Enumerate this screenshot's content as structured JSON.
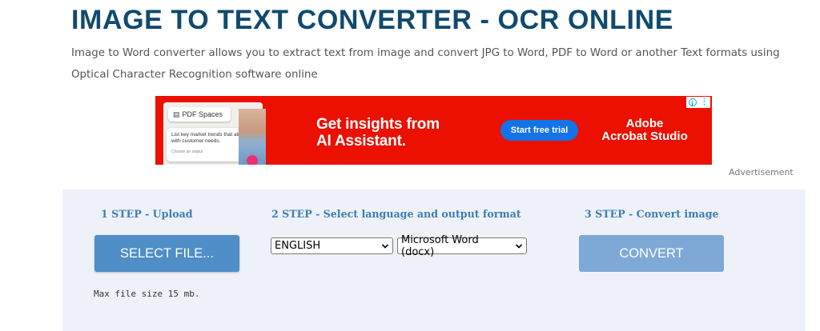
{
  "header": {
    "title": "IMAGE TO TEXT CONVERTER - OCR ONLINE",
    "description": "Image to Word converter allows you to extract text from image and convert JPG to Word, PDF to Word or another Text formats using Optical Character Recognition software online"
  },
  "ad": {
    "mock_chip": "PDF Spaces",
    "mock_prompt": "List key market trends that align with customer needs.",
    "mock_prompt_sub": "Choose an output",
    "headline_line1": "Get insights from",
    "headline_line2": "AI Assistant.",
    "cta": "Start free trial",
    "brand_line1": "Adobe",
    "brand_line2": "Acrobat Studio",
    "info_icon": "i",
    "menu_icon": "⋮",
    "label": "Advertisement",
    "colors": {
      "background": "#eb1000",
      "cta": "#1473e6"
    }
  },
  "converter": {
    "steps": [
      {
        "label": "1 STEP - Upload"
      },
      {
        "label": "2 STEP - Select language and output format"
      },
      {
        "label": "3 STEP - Convert image"
      }
    ],
    "select_file_label": "SELECT FILE...",
    "language_selected": "ENGLISH",
    "format_selected": "Microsoft Word (docx)",
    "convert_label": "CONVERT",
    "max_size_note": "Max file size 15 mb.",
    "colors": {
      "step_text": "#3f7db4",
      "select_button": "#4f8ec7",
      "convert_button": "#7ea9d6",
      "panel_bg": "#eef2f8"
    }
  }
}
